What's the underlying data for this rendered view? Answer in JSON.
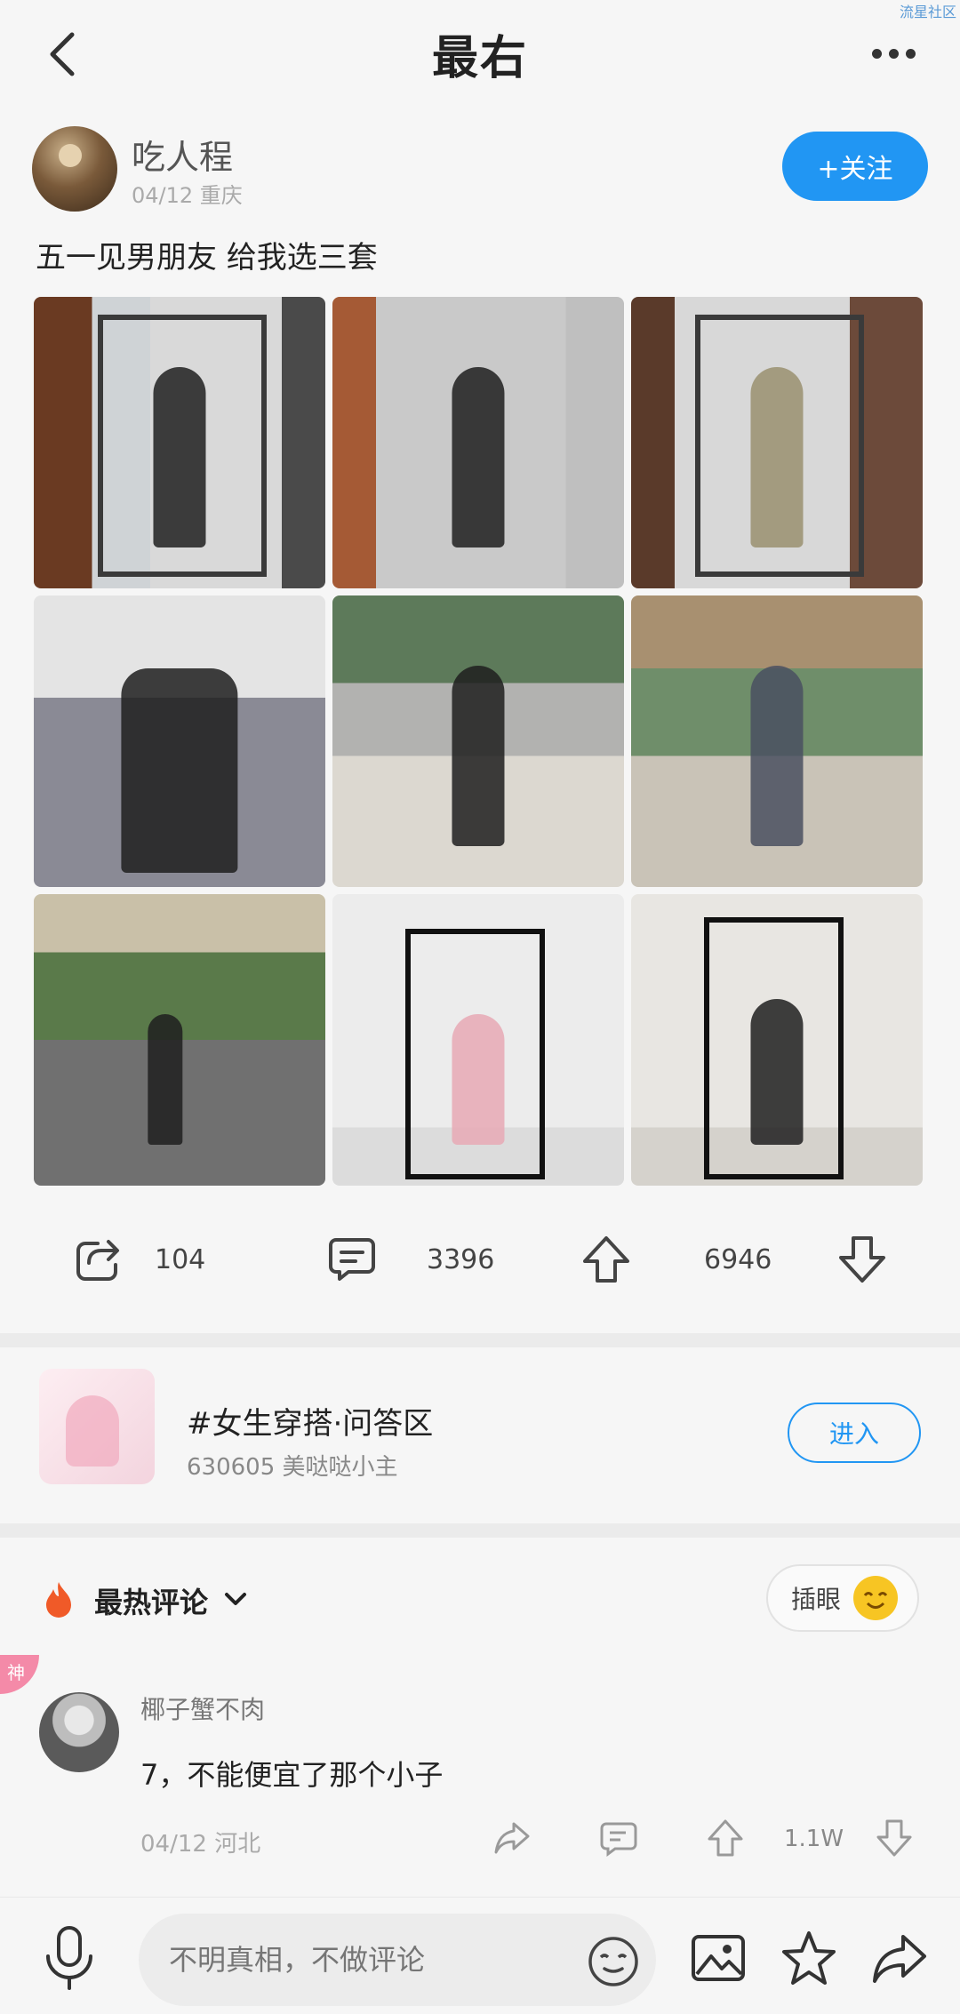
{
  "watermark": "流星社区",
  "header": {
    "title": "最右"
  },
  "post": {
    "author": "吃人程",
    "meta": "04/12 重庆",
    "follow_label": "+关注",
    "text": "五一见男朋友  给我选三套"
  },
  "actions": {
    "shares": "104",
    "comments": "3396",
    "upvotes": "6946"
  },
  "topic": {
    "title": "#女生穿搭·问答区",
    "meta": "630605 美哒哒小主",
    "enter_label": "进入"
  },
  "comments_header": {
    "sort_label": "最热评论",
    "insert_eye_label": "插眼"
  },
  "comment": {
    "badge": "神",
    "user": "椰子蟹不肉",
    "text": "7，不能便宜了那个小子",
    "meta": "04/12 河北",
    "likes": "1.1W"
  },
  "bottom_bar": {
    "input_placeholder": "不明真相，不做评论"
  },
  "colors": {
    "accent": "#2196f3",
    "badge": "#f48aa8",
    "fire": "#f05a28"
  }
}
